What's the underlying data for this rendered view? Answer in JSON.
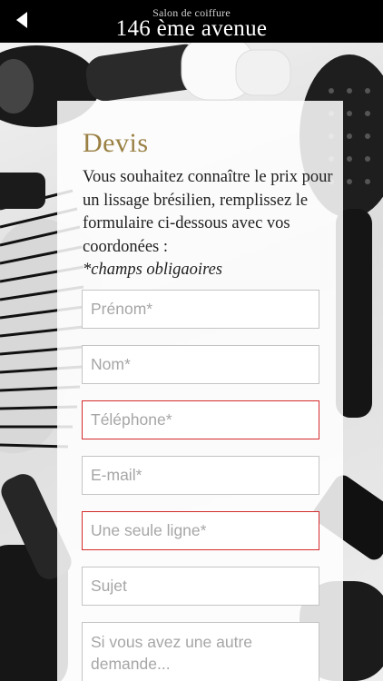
{
  "header": {
    "subtitle": "Salon de coiffure",
    "title": "146 ème avenue",
    "back_icon": "chevron-left-icon"
  },
  "form": {
    "heading": "Devis",
    "intro": "Vous souhaitez connaître le prix pour un lissage brésilien, remplissez le formulaire ci-dessous avec vos coordonées :",
    "required_note": "*champs obligaoires",
    "fields": {
      "first_name": {
        "placeholder": "Prénom*",
        "error": false
      },
      "last_name": {
        "placeholder": "Nom*",
        "error": false
      },
      "phone": {
        "placeholder": "Téléphone*",
        "error": true
      },
      "email": {
        "placeholder": "E-mail*",
        "error": false
      },
      "one_line": {
        "placeholder": "Une seule ligne*",
        "error": true
      },
      "subject": {
        "placeholder": "Sujet",
        "error": false
      },
      "message": {
        "placeholder": "Si vous avez une autre demande...",
        "error": false
      }
    }
  },
  "colors": {
    "header_bg": "#000000",
    "heading_gold": "#9a8044",
    "error_border": "#d52a2a"
  }
}
